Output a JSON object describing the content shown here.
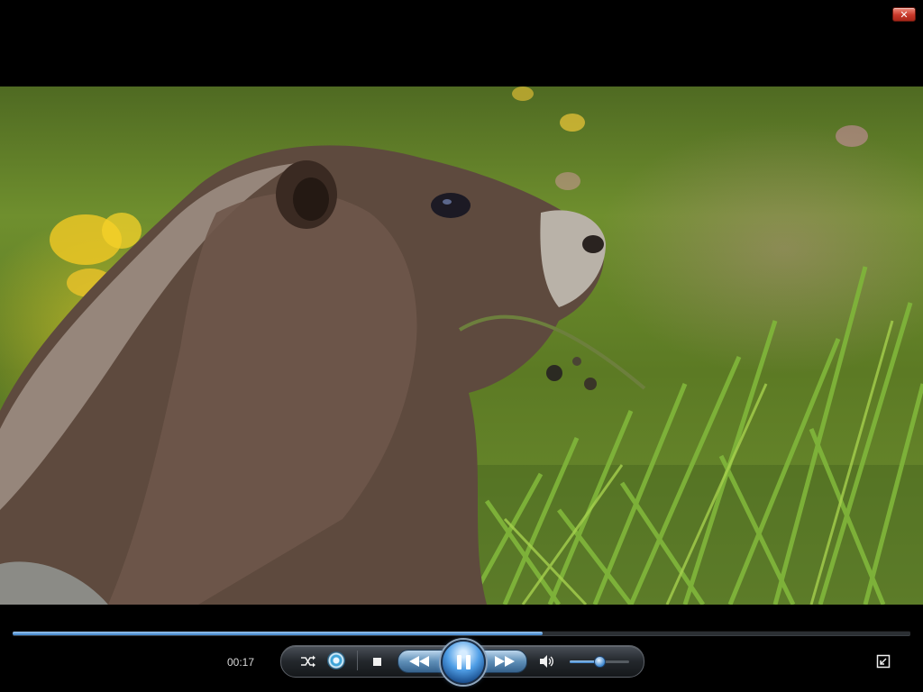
{
  "window": {
    "close_label": "✕"
  },
  "video": {
    "subject": "marmot-eating-grass"
  },
  "playback": {
    "current_time": "00:17",
    "progress_fraction": 0.59,
    "state": "playing"
  },
  "volume": {
    "level_fraction": 0.5
  },
  "controls": {
    "shuffle_icon": "shuffle-icon",
    "repeat_icon": "repeat-icon",
    "stop_icon": "stop-icon",
    "rewind_icon": "rewind-icon",
    "pause_icon": "pause-icon",
    "forward_icon": "fast-forward-icon",
    "volume_icon": "speaker-icon",
    "view_icon": "switch-to-library-icon"
  },
  "colors": {
    "accent": "#3a7fc8",
    "close": "#c9382a",
    "bar_background": "#000000"
  }
}
